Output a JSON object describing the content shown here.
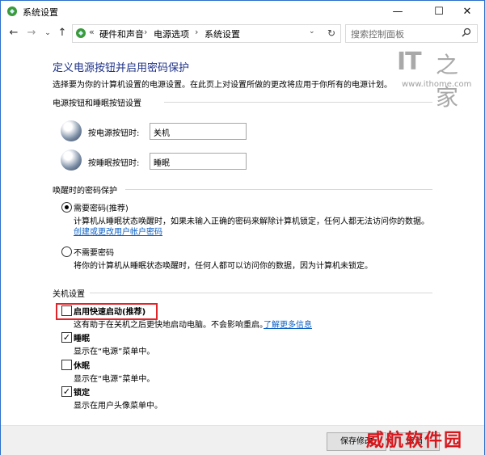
{
  "window": {
    "title": "系统设置",
    "minimize": "—",
    "maximize": "☐",
    "close": "✕"
  },
  "nav": {
    "back": "←",
    "forward": "→",
    "history": "⌄",
    "up": "↑",
    "address_overflow": "«",
    "crumbs": [
      "硬件和声音",
      "电源选项",
      "系统设置"
    ],
    "crumb_separator": "›",
    "dropdown": "⌄",
    "refresh": "↻",
    "search_placeholder": "搜索控制面板",
    "search_icon": "search-icon"
  },
  "header": {
    "title": "定义电源按钮并启用密码保护",
    "description": "选择要为你的计算机设置的电源设置。在此页上对设置所做的更改将应用于你所有的电源计划。"
  },
  "power_section": {
    "title": "电源按钮和睡眠按钮设置",
    "power_label": "按电源按钮时:",
    "power_value": "关机",
    "sleep_label": "按睡眠按钮时:",
    "sleep_value": "睡眠"
  },
  "password_section": {
    "title": "唤醒时的密码保护",
    "require_label": "需要密码(推荐)",
    "require_desc": "计算机从睡眠状态唤醒时，如果未输入正确的密码来解除计算机锁定，任何人都无法访问你的数据。",
    "require_link": "创建或更改用户帐户密码",
    "norequire_label": "不需要密码",
    "norequire_desc": "将你的计算机从睡眠状态唤醒时，任何人都可以访问你的数据，因为计算机未锁定。",
    "selected": "require"
  },
  "shutdown_section": {
    "title": "关机设置",
    "items": [
      {
        "label": "启用快速启动(推荐)",
        "checked": false,
        "desc": "这有助于在关机之后更快地启动电脑。不会影响重启。",
        "link": "了解更多信息"
      },
      {
        "label": "睡眠",
        "checked": true,
        "desc": "显示在“电源”菜单中。"
      },
      {
        "label": "休眠",
        "checked": false,
        "desc": "显示在“电源”菜单中。"
      },
      {
        "label": "锁定",
        "checked": true,
        "desc": "显示在用户头像菜单中。"
      }
    ]
  },
  "buttons": {
    "save": "保存修改",
    "cancel": "取消"
  },
  "logo": {
    "brand": "IT",
    "brand_cn": "之家",
    "url": "www.ithome.com"
  },
  "watermark": "威航软件园",
  "colors": {
    "title_blue": "#1e3287",
    "link_blue": "#0a5fc4",
    "highlight_red": "#e0242a",
    "watermark_red": "#d8171d"
  }
}
